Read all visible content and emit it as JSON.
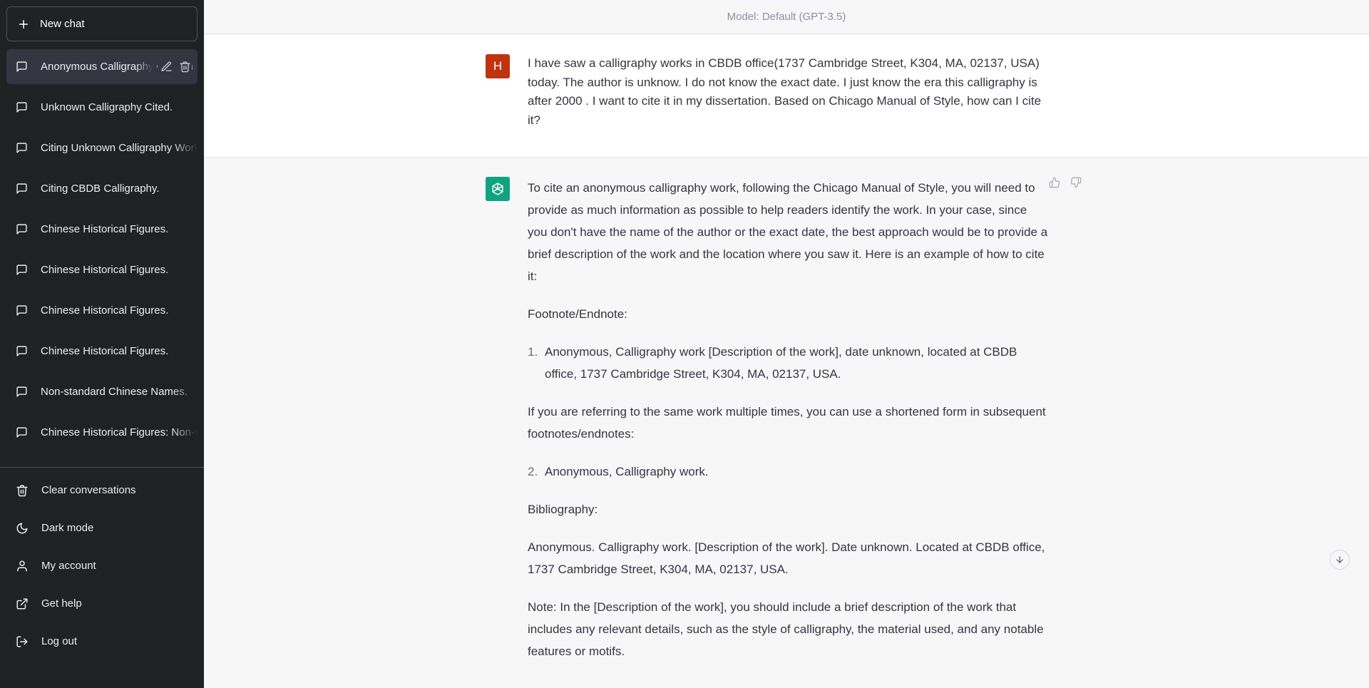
{
  "sidebar": {
    "new_chat_label": "New chat",
    "conversations": [
      {
        "label": "Anonymous Calligraphy Citation",
        "active": true
      },
      {
        "label": "Unknown Calligraphy Cited."
      },
      {
        "label": "Citing Unknown Calligraphy Work"
      },
      {
        "label": "Citing CBDB Calligraphy."
      },
      {
        "label": "Chinese Historical Figures."
      },
      {
        "label": "Chinese Historical Figures."
      },
      {
        "label": "Chinese Historical Figures."
      },
      {
        "label": "Chinese Historical Figures."
      },
      {
        "label": "Non-standard Chinese Names."
      },
      {
        "label": "Chinese Historical Figures: Non-standard"
      }
    ],
    "menu": {
      "clear": "Clear conversations",
      "dark_mode": "Dark mode",
      "account": "My account",
      "help": "Get help",
      "logout": "Log out"
    }
  },
  "main": {
    "model_label": "Model: Default (GPT-3.5)",
    "user_avatar_letter": "H",
    "user_message": "I have saw a calligraphy works in CBDB office(1737 Cambridge Street, K304, MA, 02137, USA) today. The author is unknow. I do not know the exact date. I just know the era this calligraphy is after 2000 . I want to cite it in my dissertation. Based on Chicago Manual of Style, how can I cite it?",
    "response": {
      "intro": "To cite an anonymous calligraphy work, following the Chicago Manual of Style, you will need to provide as much information as possible to help readers identify the work. In your case, since you don't have the name of the author or the exact date, the best approach would be to provide a brief description of the work and the location where you saw it. Here is an example of how to cite it:",
      "footnote_heading": "Footnote/Endnote:",
      "item1_num": "1.",
      "item1": "Anonymous, Calligraphy work [Description of the work], date unknown, located at CBDB office, 1737 Cambridge Street, K304, MA, 02137, USA.",
      "shortened": "If you are referring to the same work multiple times, you can use a shortened form in subsequent footnotes/endnotes:",
      "item2_num": "2.",
      "item2": "Anonymous, Calligraphy work.",
      "bib_heading": "Bibliography:",
      "bib_entry": "Anonymous. Calligraphy work. [Description of the work]. Date unknown. Located at CBDB office, 1737 Cambridge Street, K304, MA, 02137, USA.",
      "note": "Note: In the [Description of the work], you should include a brief description of the work that includes any relevant details, such as the style of calligraphy, the material used, and any notable features or motifs."
    }
  },
  "icons": {
    "new_chat": "plus-icon",
    "conversation": "chat-bubble-icon",
    "edit": "pencil-icon",
    "delete": "trash-icon",
    "clear": "trash-icon",
    "dark_mode": "moon-icon",
    "account": "user-icon",
    "help": "external-link-icon",
    "logout": "logout-icon",
    "thumbs_up": "thumbs-up-icon",
    "thumbs_down": "thumbs-down-icon",
    "scroll_down": "arrow-down-icon",
    "bot_avatar": "openai-logo-icon"
  },
  "colors": {
    "sidebar_bg": "#202123",
    "active_item_bg": "#343541",
    "user_avatar_bg": "#c1320f",
    "bot_avatar_bg": "#10a37f"
  }
}
